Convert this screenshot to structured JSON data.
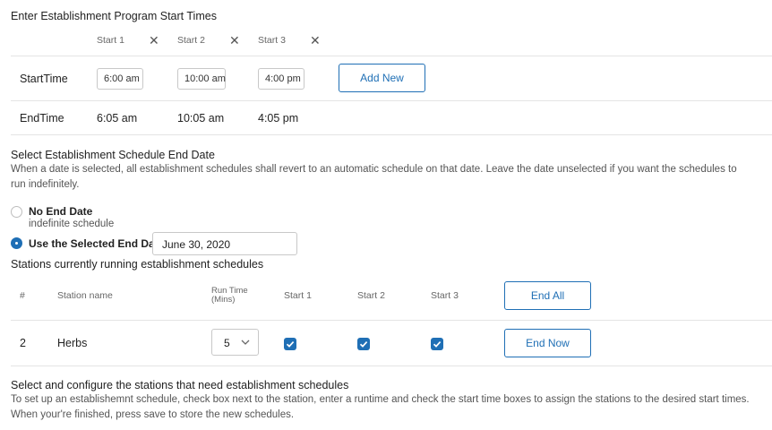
{
  "program": {
    "title": "Enter Establishment Program Start Times",
    "headers": [
      "Start 1",
      "Start 2",
      "Start 3"
    ],
    "remove_icon": "close-icon",
    "start_label": "StartTime",
    "end_label": "EndTime",
    "start_values": [
      "6:00 am",
      "10:00 am",
      "4:00 pm"
    ],
    "end_values": [
      "6:05 am",
      "10:05 am",
      "4:05 pm"
    ],
    "add_new_label": "Add New"
  },
  "end_date": {
    "title": "Select Establishment Schedule End Date",
    "description": "When a date is selected, all establishment schedules shall revert to an automatic schedule on that date. Leave the date unselected if you want the schedules to run indefinitely.",
    "no_end_label": "No End Date",
    "no_end_sub": "indefinite schedule",
    "use_selected_label": "Use the Selected End Date",
    "date_value": "June 30, 2020",
    "selected_option": "use_selected"
  },
  "stations": {
    "title": "Stations currently running establishment schedules",
    "columns": {
      "num": "#",
      "name": "Station name",
      "runtime": "Run Time\n(Mins)",
      "start1": "Start 1",
      "start2": "Start 2",
      "start3": "Start 3"
    },
    "end_all_label": "End All",
    "rows": [
      {
        "num": "2",
        "name": "Herbs",
        "runtime": "5",
        "start1": true,
        "start2": true,
        "start3": true,
        "end_now_label": "End Now"
      }
    ]
  },
  "configure": {
    "title": "Select and configure the stations that need establishment schedules",
    "description": "To set up an establishemnt schedule, check box next to the station, enter a runtime and check the start time boxes to assign the stations to the desired start times. When your're finished, press save to store the new schedules."
  },
  "colors": {
    "accent": "#1f6fb5",
    "divider": "#e4e4e4",
    "muted_text": "#555555"
  }
}
